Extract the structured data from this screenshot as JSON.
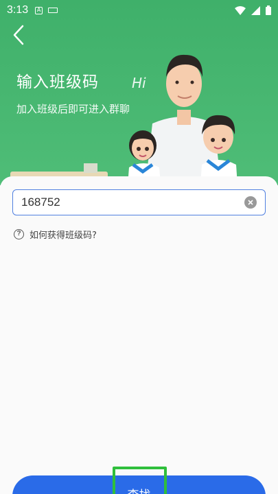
{
  "status_bar": {
    "time": "3:13",
    "notification_icon_letter": "A",
    "icons": [
      "notification-a-icon",
      "keyboard-icon",
      "wifi-icon",
      "signal-icon",
      "battery-icon"
    ]
  },
  "header": {
    "title": "输入班级码",
    "subtitle": "加入班级后即可进入群聊",
    "bubble_text": "Hi"
  },
  "form": {
    "class_code_value": "168752",
    "help_text": "如何获得班级码?"
  },
  "actions": {
    "find_label": "查找"
  },
  "colors": {
    "header_green": "#3fb06a",
    "primary_blue": "#2a6be8",
    "input_border": "#4f7fe0",
    "highlight_green": "#2fbf3c"
  }
}
